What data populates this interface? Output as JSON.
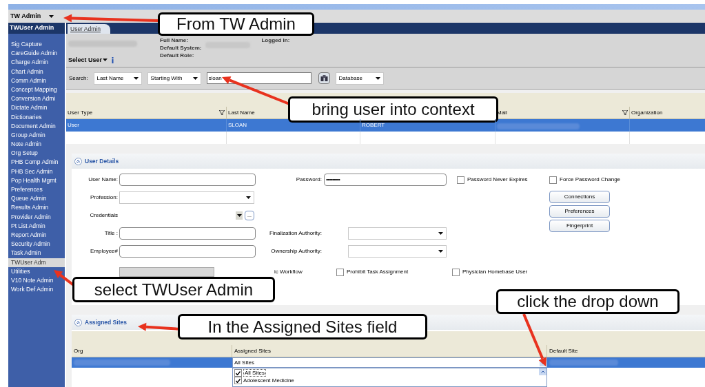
{
  "top_bar": {
    "title": "TW Admin"
  },
  "sidebar": {
    "header": "TWUser Admin",
    "items": [
      {
        "label": "Sig Capture",
        "selected": false
      },
      {
        "label": "CareGuide Admin",
        "selected": false
      },
      {
        "label": "Charge Admin",
        "selected": false
      },
      {
        "label": "Chart Admin",
        "selected": false
      },
      {
        "label": "Comm Admin",
        "selected": false
      },
      {
        "label": "Concept Mapping",
        "selected": false
      },
      {
        "label": "Conversion Admi",
        "selected": false
      },
      {
        "label": "Dictate Admin",
        "selected": false
      },
      {
        "label": "Dictionaries",
        "selected": false
      },
      {
        "label": "Document Admin",
        "selected": false
      },
      {
        "label": "Group Admin",
        "selected": false
      },
      {
        "label": "Note Admin",
        "selected": false
      },
      {
        "label": "Org Setup",
        "selected": false
      },
      {
        "label": "PHB Comp Admin",
        "selected": false
      },
      {
        "label": "PHB Sec Admin",
        "selected": false
      },
      {
        "label": "Pop Health Mgmt",
        "selected": false
      },
      {
        "label": "Preferences",
        "selected": false
      },
      {
        "label": "Queue Admin",
        "selected": false
      },
      {
        "label": "Results Admin",
        "selected": false
      },
      {
        "label": "Provider Admin",
        "selected": false
      },
      {
        "label": "Pt List Admin",
        "selected": false
      },
      {
        "label": "Report Admin",
        "selected": false
      },
      {
        "label": "Security Admin",
        "selected": false
      },
      {
        "label": "Task Admin",
        "selected": false
      },
      {
        "label": "TWUser Adm",
        "selected": true
      },
      {
        "label": "Utilities",
        "selected": false
      },
      {
        "label": "V10 Note Admin",
        "selected": false
      },
      {
        "label": "Work Def Admin",
        "selected": false
      }
    ]
  },
  "tabs": [
    {
      "label": "User Admin",
      "selected": true
    }
  ],
  "user_header": {
    "select_user": "Select User",
    "info_fields": [
      "Full Name:",
      "Default System:",
      "Default Role:"
    ],
    "logged_in": "Logged In:"
  },
  "search": {
    "label": "Search:",
    "field": "Last Name",
    "match": "Starting With",
    "value": "sloan",
    "source": "Database"
  },
  "users_table": {
    "columns": [
      {
        "label": "User Type",
        "filter": true
      },
      {
        "label": "Last Name"
      },
      {},
      {
        "label": "Mail",
        "filter": true
      },
      {
        "label": "Organization",
        "filter": false
      }
    ],
    "rows": [
      {
        "cells": [
          "User",
          "SLOAN",
          "ROBERT"
        ],
        "selected": true
      },
      {
        "selected": false
      }
    ]
  },
  "user_details": {
    "title": "User Details",
    "left_fields": [
      {
        "label": "User Name:",
        "kind": "text"
      },
      {
        "label": "Profession:",
        "kind": "select"
      },
      {
        "label": "Credentials",
        "kind": "picker"
      },
      {
        "label": "Title :",
        "kind": "text"
      },
      {
        "label": "Employee#",
        "kind": "text"
      }
    ],
    "password": {
      "label": "Password:",
      "value": "•••••••••••"
    },
    "authorities": [
      {
        "label": "Finalization Authority:"
      },
      {
        "label": "Ownership Authority:"
      }
    ],
    "top_checkboxes": [
      {
        "label": "Password Never Expires",
        "checked": false
      },
      {
        "label": "Force Password Change",
        "checked": false
      }
    ],
    "buttons": [
      "Connections",
      "Preferences",
      "Fingerprint"
    ],
    "browse_label": "...",
    "workflow_label": "ic Workflow",
    "bottom_checkboxes": [
      {
        "label": "Prohibit Task Assignment",
        "checked": false
      },
      {
        "label": "Physician Homebase User",
        "checked": false
      }
    ]
  },
  "assigned_sites": {
    "title": "Assigned Sites",
    "columns": [
      "Org",
      "Assigned Sites",
      "Default Site"
    ],
    "selected_value": "All Sites",
    "options": [
      {
        "label": "All Sites",
        "checked": true
      },
      {
        "label": "Adolescent Medicine",
        "checked": true
      }
    ]
  },
  "callouts": [
    {
      "text": "From TW Admin"
    },
    {
      "text": "bring user into context"
    },
    {
      "text": "select TWUser Admin"
    },
    {
      "text": "In the Assigned Sites field"
    },
    {
      "text": "click the drop down"
    }
  ]
}
